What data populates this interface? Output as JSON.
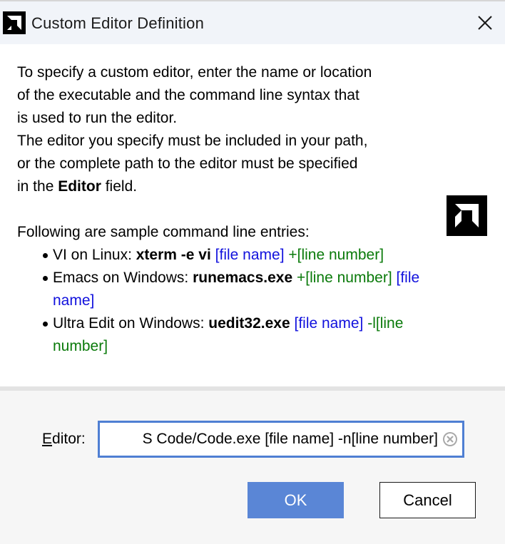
{
  "window": {
    "title": "Custom Editor Definition"
  },
  "description": {
    "line1": "To specify a custom editor, enter the name or location",
    "line2": "of the executable and the command line syntax that",
    "line3": "is used to run the editor.",
    "line4": "The editor you specify must be included in your path,",
    "line5": "or the complete path to the editor must be specified",
    "line6_prefix": "in the ",
    "line6_bold": "Editor",
    "line6_suffix": " field.",
    "samples_intro": "Following are sample command line entries:"
  },
  "samples": [
    {
      "prefix": "VI on Linux: ",
      "command": "xterm -e vi",
      "part1": " [file name]",
      "part2": " +[line number]"
    },
    {
      "prefix": "Emacs on Windows: ",
      "command": "runemacs.exe",
      "part1": " +[line number]",
      "part2": " [file name]"
    },
    {
      "prefix": "Ultra Edit on Windows: ",
      "command": "uedit32.exe",
      "part1": " [file name]",
      "part2": " -l[line number]"
    }
  ],
  "editor": {
    "label_underlined": "E",
    "label_rest": "ditor:",
    "value": "S Code/Code.exe [file name] -n[line number]"
  },
  "buttons": {
    "ok": "OK",
    "cancel": "Cancel"
  },
  "colors": {
    "file_name": "#1111dd",
    "line_number": "#0a7a0a",
    "field_border": "#4f7fd3",
    "ok_button": "#5a86d6"
  },
  "icons": {
    "app_logo": "amd-logo-icon",
    "close": "close-icon",
    "clear": "clear-circle-icon"
  }
}
